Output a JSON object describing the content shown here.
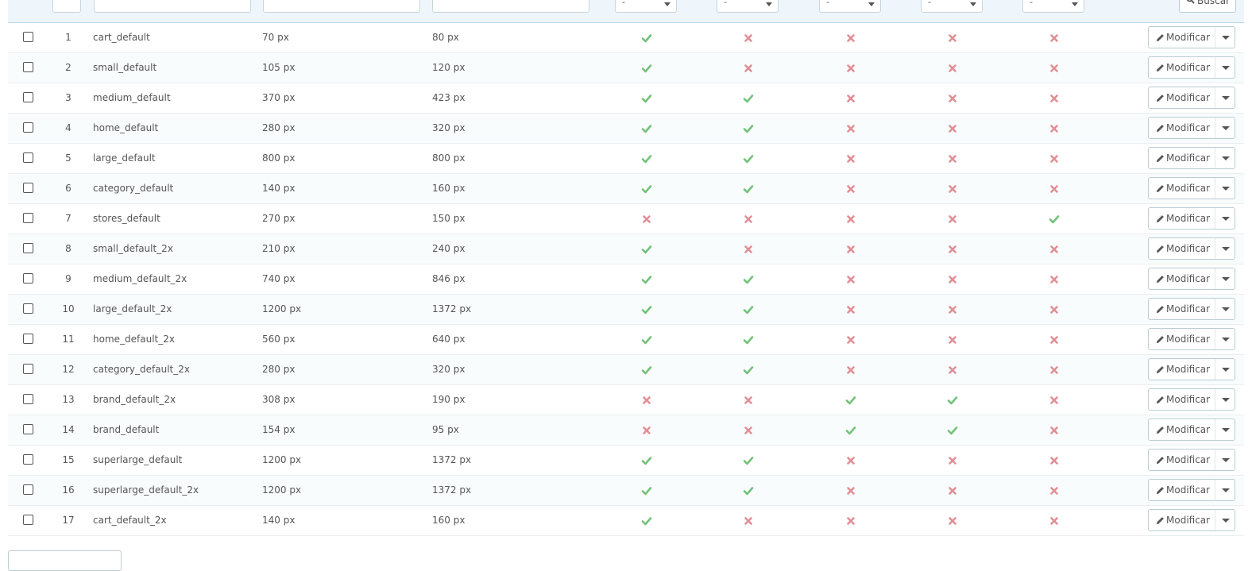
{
  "filters": {
    "select_value": "-",
    "search_label": "Buscar"
  },
  "colors": {
    "check": "#72c279",
    "cross": "#e08f95",
    "header_bg": "#eff6fb"
  },
  "row_action_label": "Modificar",
  "rows": [
    {
      "id": "1",
      "name": "cart_default",
      "width": "70 px",
      "height": "80 px",
      "flags": [
        true,
        false,
        false,
        false,
        false
      ]
    },
    {
      "id": "2",
      "name": "small_default",
      "width": "105 px",
      "height": "120 px",
      "flags": [
        true,
        false,
        false,
        false,
        false
      ]
    },
    {
      "id": "3",
      "name": "medium_default",
      "width": "370 px",
      "height": "423 px",
      "flags": [
        true,
        true,
        false,
        false,
        false
      ]
    },
    {
      "id": "4",
      "name": "home_default",
      "width": "280 px",
      "height": "320 px",
      "flags": [
        true,
        true,
        false,
        false,
        false
      ]
    },
    {
      "id": "5",
      "name": "large_default",
      "width": "800 px",
      "height": "800 px",
      "flags": [
        true,
        true,
        false,
        false,
        false
      ]
    },
    {
      "id": "6",
      "name": "category_default",
      "width": "140 px",
      "height": "160 px",
      "flags": [
        true,
        true,
        false,
        false,
        false
      ]
    },
    {
      "id": "7",
      "name": "stores_default",
      "width": "270 px",
      "height": "150 px",
      "flags": [
        false,
        false,
        false,
        false,
        true
      ]
    },
    {
      "id": "8",
      "name": "small_default_2x",
      "width": "210 px",
      "height": "240 px",
      "flags": [
        true,
        false,
        false,
        false,
        false
      ]
    },
    {
      "id": "9",
      "name": "medium_default_2x",
      "width": "740 px",
      "height": "846 px",
      "flags": [
        true,
        true,
        false,
        false,
        false
      ]
    },
    {
      "id": "10",
      "name": "large_default_2x",
      "width": "1200 px",
      "height": "1372 px",
      "flags": [
        true,
        true,
        false,
        false,
        false
      ]
    },
    {
      "id": "11",
      "name": "home_default_2x",
      "width": "560 px",
      "height": "640 px",
      "flags": [
        true,
        true,
        false,
        false,
        false
      ]
    },
    {
      "id": "12",
      "name": "category_default_2x",
      "width": "280 px",
      "height": "320 px",
      "flags": [
        true,
        true,
        false,
        false,
        false
      ]
    },
    {
      "id": "13",
      "name": "brand_default_2x",
      "width": "308 px",
      "height": "190 px",
      "flags": [
        false,
        false,
        true,
        true,
        false
      ]
    },
    {
      "id": "14",
      "name": "brand_default",
      "width": "154 px",
      "height": "95 px",
      "flags": [
        false,
        false,
        true,
        true,
        false
      ]
    },
    {
      "id": "15",
      "name": "superlarge_default",
      "width": "1200 px",
      "height": "1372 px",
      "flags": [
        true,
        true,
        false,
        false,
        false
      ]
    },
    {
      "id": "16",
      "name": "superlarge_default_2x",
      "width": "1200 px",
      "height": "1372 px",
      "flags": [
        true,
        true,
        false,
        false,
        false
      ]
    },
    {
      "id": "17",
      "name": "cart_default_2x",
      "width": "140 px",
      "height": "160 px",
      "flags": [
        true,
        false,
        false,
        false,
        false
      ]
    }
  ]
}
